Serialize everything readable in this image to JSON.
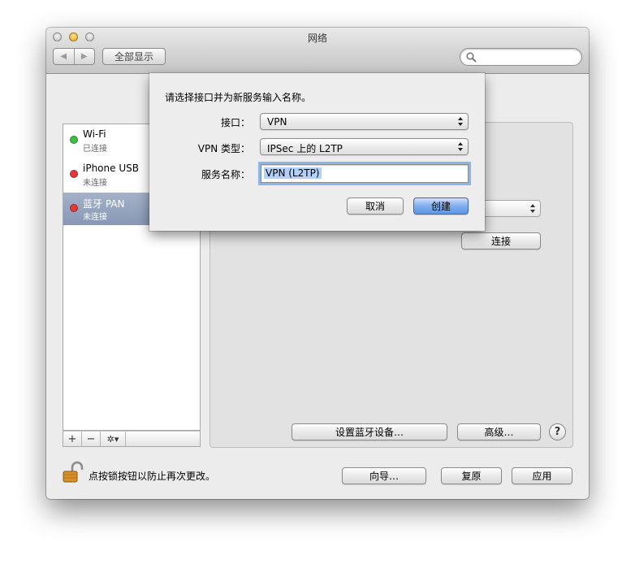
{
  "window": {
    "title": "网络",
    "show_all": "全部显示",
    "search_placeholder": ""
  },
  "services": [
    {
      "name": "Wi-Fi",
      "status": "已连接",
      "color": "#3fbf3f"
    },
    {
      "name": "iPhone USB",
      "status": "未连接",
      "color": "#e23a3a"
    },
    {
      "name": "蓝牙 PAN",
      "status": "未连接",
      "color": "#e23a3a",
      "selected": true
    }
  ],
  "list_bar": {
    "add": "+",
    "remove": "−",
    "action": "✲▾"
  },
  "pane": {
    "connect_button": "连接",
    "setup_bluetooth_button": "设置蓝牙设备…",
    "advanced_button": "高级…",
    "help_button": "?"
  },
  "footer": {
    "lock_text": "点按锁按钮以防止再次更改。",
    "assist_button": "向导…",
    "revert_button": "复原",
    "apply_button": "应用"
  },
  "sheet": {
    "title": "请选择接口并为新服务输入名称。",
    "interface_label": "接口：",
    "interface_value": "VPN",
    "vpn_type_label": "VPN 类型：",
    "vpn_type_value": "IPSec 上的 L2TP",
    "service_name_label": "服务名称：",
    "service_name_value": "VPN (L2TP)",
    "cancel_button": "取消",
    "create_button": "创建"
  },
  "colors": {
    "accent": "#5d96e6",
    "selection": "#8898b4",
    "text_highlight": "#b2d1f8"
  }
}
